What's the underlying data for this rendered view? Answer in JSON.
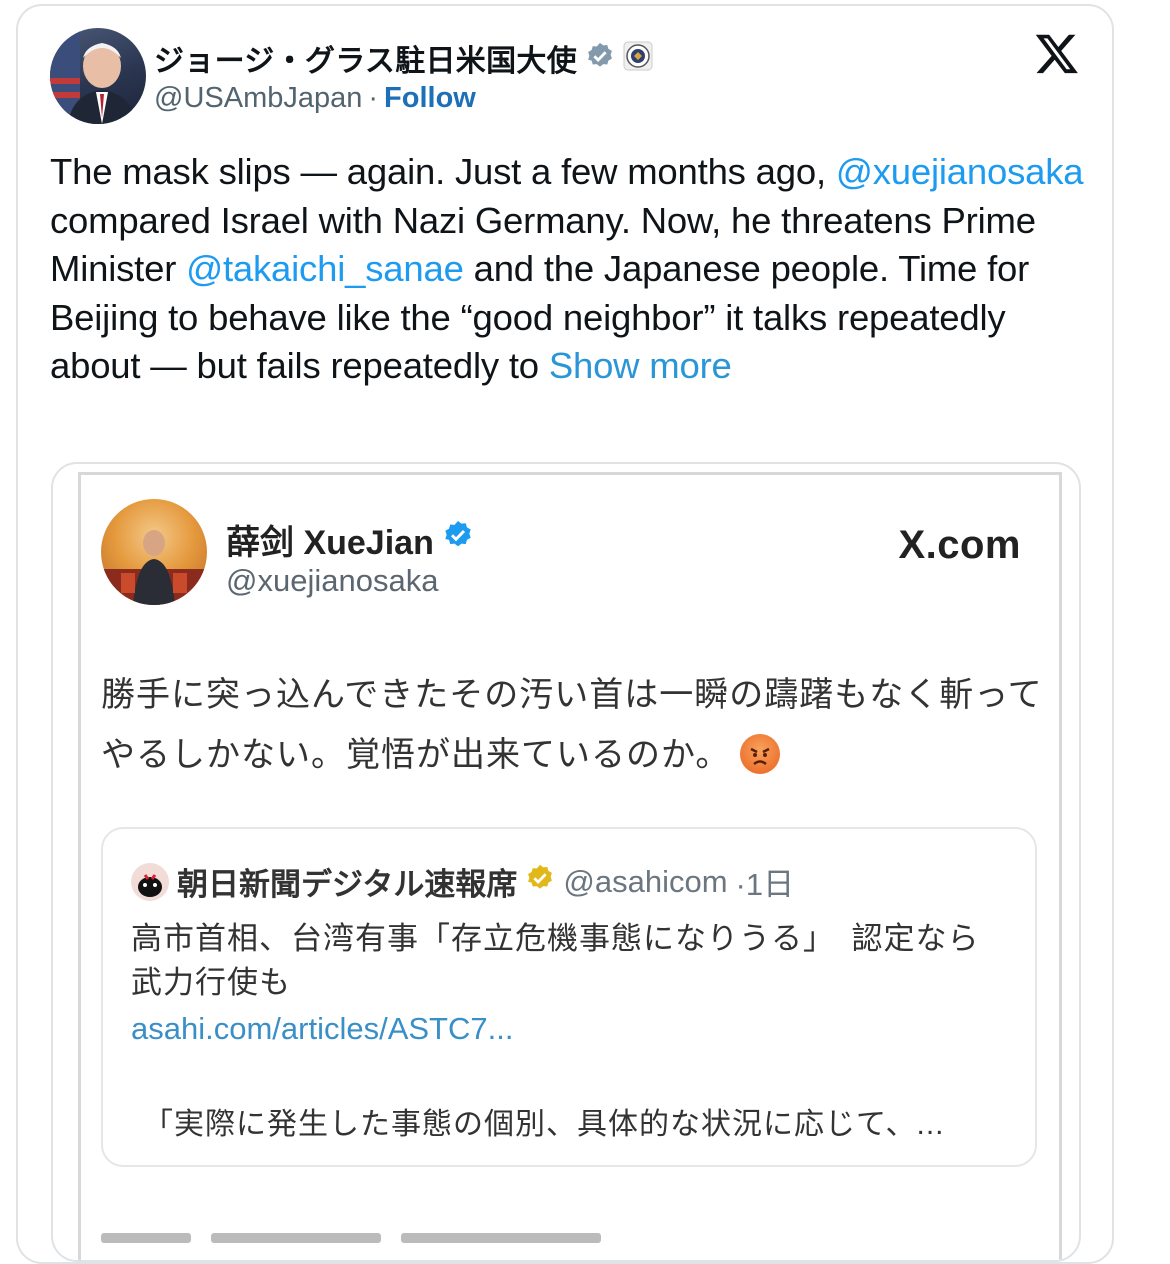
{
  "author": {
    "name": "ジョージ・グラス駐日米国大使",
    "handle": "@USAmbJapan",
    "separator": "·",
    "follow_label": "Follow"
  },
  "tweet": {
    "segments": [
      {
        "text": "The mask slips — again. Just a few months ago, ",
        "type": "text"
      },
      {
        "text": "@xuejianosaka",
        "type": "mention"
      },
      {
        "text": " compared Israel with Nazi Germany. Now, he threatens Prime Minister ",
        "type": "text"
      },
      {
        "text": "@takaichi_sanae",
        "type": "mention"
      },
      {
        "text": " and the Japanese people. Time for Beijing to behave like the “good neighbor” it talks repeatedly about — but fails repeatedly to ",
        "type": "text"
      }
    ],
    "show_more_label": "Show more"
  },
  "embedded": {
    "name": "薛剑 XueJian",
    "handle": "@xuejianosaka",
    "brand": "X.com",
    "text": "勝手に突っ込んできたその汚い首は一瞬の躊躇もなく斬ってやるしかない。覚悟が出来ているのか。",
    "quote": {
      "name": "朝日新聞デジタル速報席",
      "handle": "@asahicom",
      "time": "·1日",
      "text": "高市首相、台湾有事「存立危機事態になりうる」　認定なら武力行使も",
      "link": "asahi.com/articles/ASTC7...",
      "excerpt": "「実際に発生した事態の個別、具体的な状況に応じて、..."
    }
  },
  "colors": {
    "link": "#1d9bf0",
    "follow": "#1d6fb8",
    "verified_gray": "#829aab",
    "verified_blue": "#1d9bf0",
    "verified_gold": "#e2b719"
  },
  "icons": [
    "verified-badge-icon",
    "state-seal-icon",
    "x-logo-icon",
    "angry-face-emoji"
  ]
}
